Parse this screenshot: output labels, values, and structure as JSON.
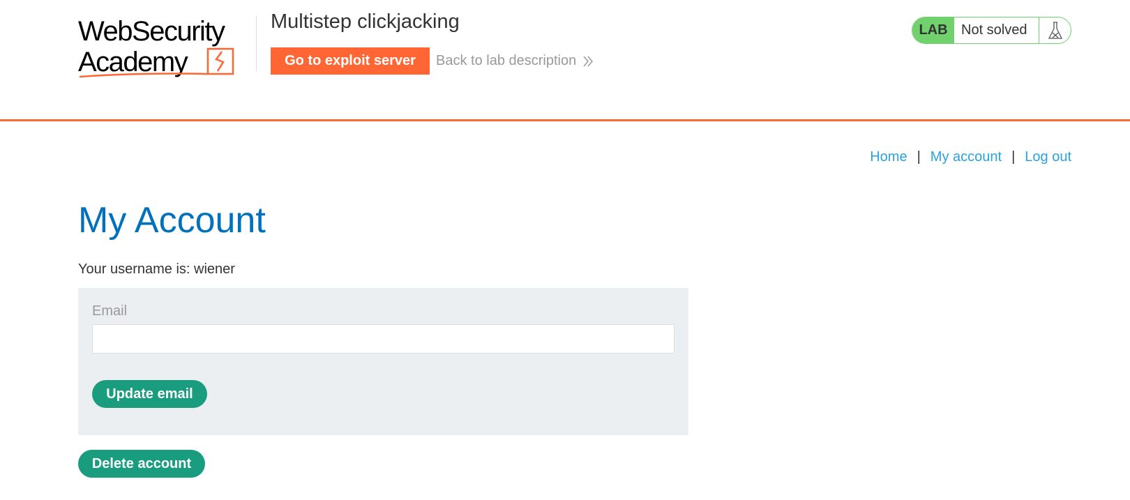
{
  "header": {
    "logo": {
      "line1": "WebSecurity",
      "line2": "Academy"
    },
    "lab_title": "Multistep clickjacking",
    "exploit_button": "Go to exploit server",
    "back_link": "Back to lab description",
    "lab_status": {
      "badge": "LAB",
      "status": "Not solved"
    }
  },
  "nav": {
    "home": "Home",
    "sep1": "|",
    "my_account": "My account",
    "sep2": "|",
    "logout": "Log out"
  },
  "main": {
    "title": "My Account",
    "username_line": "Your username is: wiener",
    "email_form": {
      "label": "Email",
      "value": "",
      "update_button": "Update email"
    },
    "delete_button": "Delete account"
  },
  "colors": {
    "accent_orange": "#ff6633",
    "link_blue": "#29a2e0",
    "title_blue": "#0071bc",
    "button_green": "#1a9c7f",
    "lab_green": "#70d16d",
    "form_background": "#ebeff2"
  },
  "icons": {
    "back_chevrons": "double-chevron-right-icon",
    "lab_flask": "flask-icon"
  }
}
